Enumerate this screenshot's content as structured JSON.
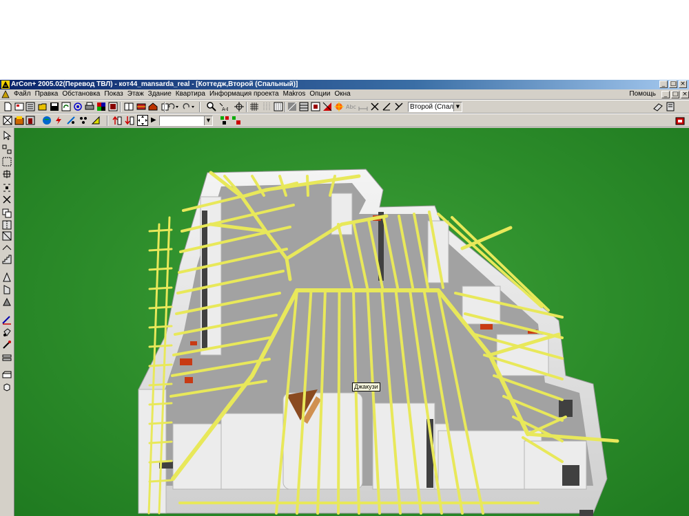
{
  "window": {
    "title": "ArCon+  2005.02(Перевод ТВЛ)  - кот44_mansarda_real - [Коттедж,Второй (Спальный)]",
    "buttons": [
      "_",
      "□",
      "×"
    ]
  },
  "menu": {
    "items": [
      "Файл",
      "Правка",
      "Обстановка",
      "Показ",
      "Этаж",
      "Здание",
      "Квартира",
      "Информация проекта",
      "Makros",
      "Опции",
      "Окна"
    ],
    "help": "Помощь",
    "mdi_buttons": [
      "_",
      "□",
      "×"
    ]
  },
  "toolbar1": {
    "icons": [
      "new-file-icon",
      "open-project-icon",
      "catalog-icon",
      "open-folder-icon",
      "save-icon",
      "refresh-icon",
      "at-icon",
      "print-icon",
      "palette-icon",
      "export-icon",
      "layout-icon",
      "texture-icon",
      "house-icon",
      "layer-icon",
      "undo-icon",
      "redo-icon",
      "zoom-icon",
      "zoom-area-icon",
      "snap-icon",
      "grid-icon",
      "dots-icon",
      "hatch-icon",
      "shading-icon",
      "wall-icon",
      "pattern-icon",
      "fill-icon",
      "color-icon",
      "light-icon",
      "text-icon",
      "dimension-icon",
      "measure-icon",
      "angle-icon",
      "cursor-icon"
    ],
    "text_icon": "Abc",
    "floor_select": "Второй (Спальны",
    "right_icons": [
      "properties-icon",
      "help-book-icon"
    ]
  },
  "toolbar2": {
    "icons": [
      "plan-view-icon",
      "construction-icon",
      "design-view-icon",
      "globe-icon",
      "lightning-icon",
      "camera-icon",
      "render-icon",
      "walk-icon",
      "floor-up-icon",
      "floor-down-icon",
      "navigate-icon"
    ],
    "arrow_glyph": "▶",
    "view_select": "",
    "right_icons": [
      "nav-cross-icon",
      "nav-stop-icon",
      "shop-icon"
    ]
  },
  "sidebar": {
    "icons": [
      "select-arrow-icon",
      "select-group-icon",
      "select-area-icon",
      "select-rotate-icon",
      "move-icon",
      "delete-icon",
      "copy-icon",
      "mirror-icon",
      "distribute-icon",
      "wall-tool-icon",
      "stairs-icon",
      "roof-icon",
      "roof-window-icon",
      "section-icon",
      "floor-icon",
      "3d-cube-icon",
      "pen-icon",
      "paint-bucket-icon",
      "brush-icon",
      "material-icon",
      "camera-path-icon",
      "object-icon"
    ]
  },
  "viewport": {
    "tooltip": "Джакузи",
    "colors": {
      "background": "#2c8c2a",
      "rafters": "#e8e85a",
      "walls": "#e4e4e4",
      "floor": "#9c9c9c"
    }
  }
}
